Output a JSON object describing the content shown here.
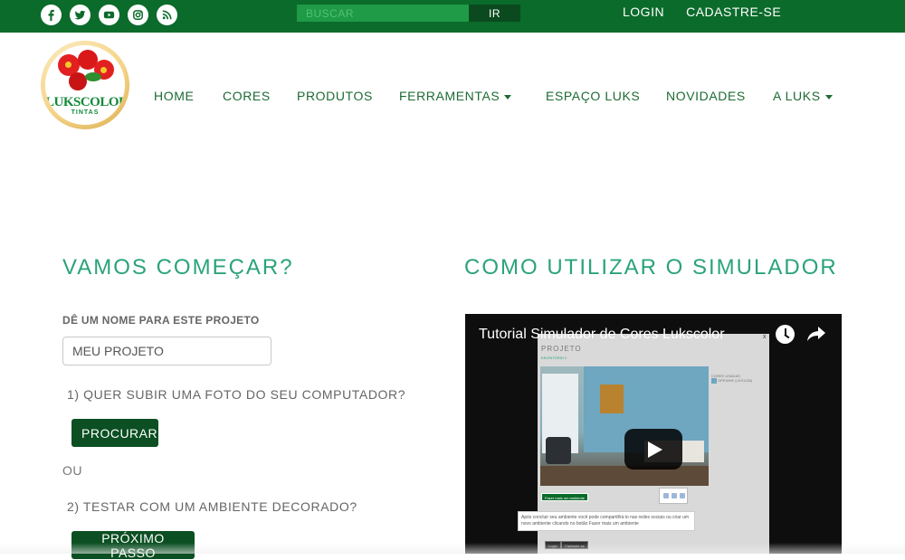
{
  "topbar": {
    "social": [
      {
        "name": "facebook-icon"
      },
      {
        "name": "twitter-icon"
      },
      {
        "name": "youtube-icon"
      },
      {
        "name": "instagram-icon"
      },
      {
        "name": "rss-icon"
      }
    ],
    "search": {
      "placeholder": "BUSCAR",
      "button": "IR"
    },
    "links": {
      "login": "LOGIN",
      "signup": "CADASTRE-SE"
    }
  },
  "logo": {
    "brand": "LUKSCOLOR",
    "sub": "TINTAS"
  },
  "nav": {
    "home": "HOME",
    "cores": "CORES",
    "produtos": "PRODUTOS",
    "ferramentas": "FERRAMENTAS",
    "espaco": "ESPAÇO LUKS",
    "novidades": "NOVIDADES",
    "aluks": "A LUKS"
  },
  "start": {
    "heading": "VAMOS COMEÇAR?",
    "label": "DÊ UM NOME PARA ESTE PROJETO",
    "project_value": "MEU PROJETO",
    "q1": "1) QUER SUBIR UMA FOTO DO SEU COMPUTADOR?",
    "browse": "PROCURAR",
    "or": "OU",
    "q2": "2) TESTAR COM UM AMBIENTE DECORADO?",
    "next": "PRÓXIMO PASSO"
  },
  "howto": {
    "heading": "COMO UTILIZAR O SIMULADOR",
    "video_title": "Tutorial Simulador de Cores Lukscolor",
    "thumb": {
      "title": "PROJETO",
      "subtitle": "ESCRITÓRIO 2",
      "colors_label": "CORES USADAS",
      "color_name": "OPENHIE (LKS1136)",
      "green_button": "Fazer mais um ambiente",
      "tip": "Após concluir seu ambiente você pode compartilhá-lo nas redes sociais ou criar um novo ambiente clicando no botão Fazer mais um ambiente",
      "login": "Login",
      "signup": "Cadastre-se",
      "close": "x"
    }
  },
  "colors": {
    "topbar": "#0b6b2b",
    "accent": "#2aa37a",
    "button": "#0b4f22",
    "nav": "#1d6b34"
  }
}
